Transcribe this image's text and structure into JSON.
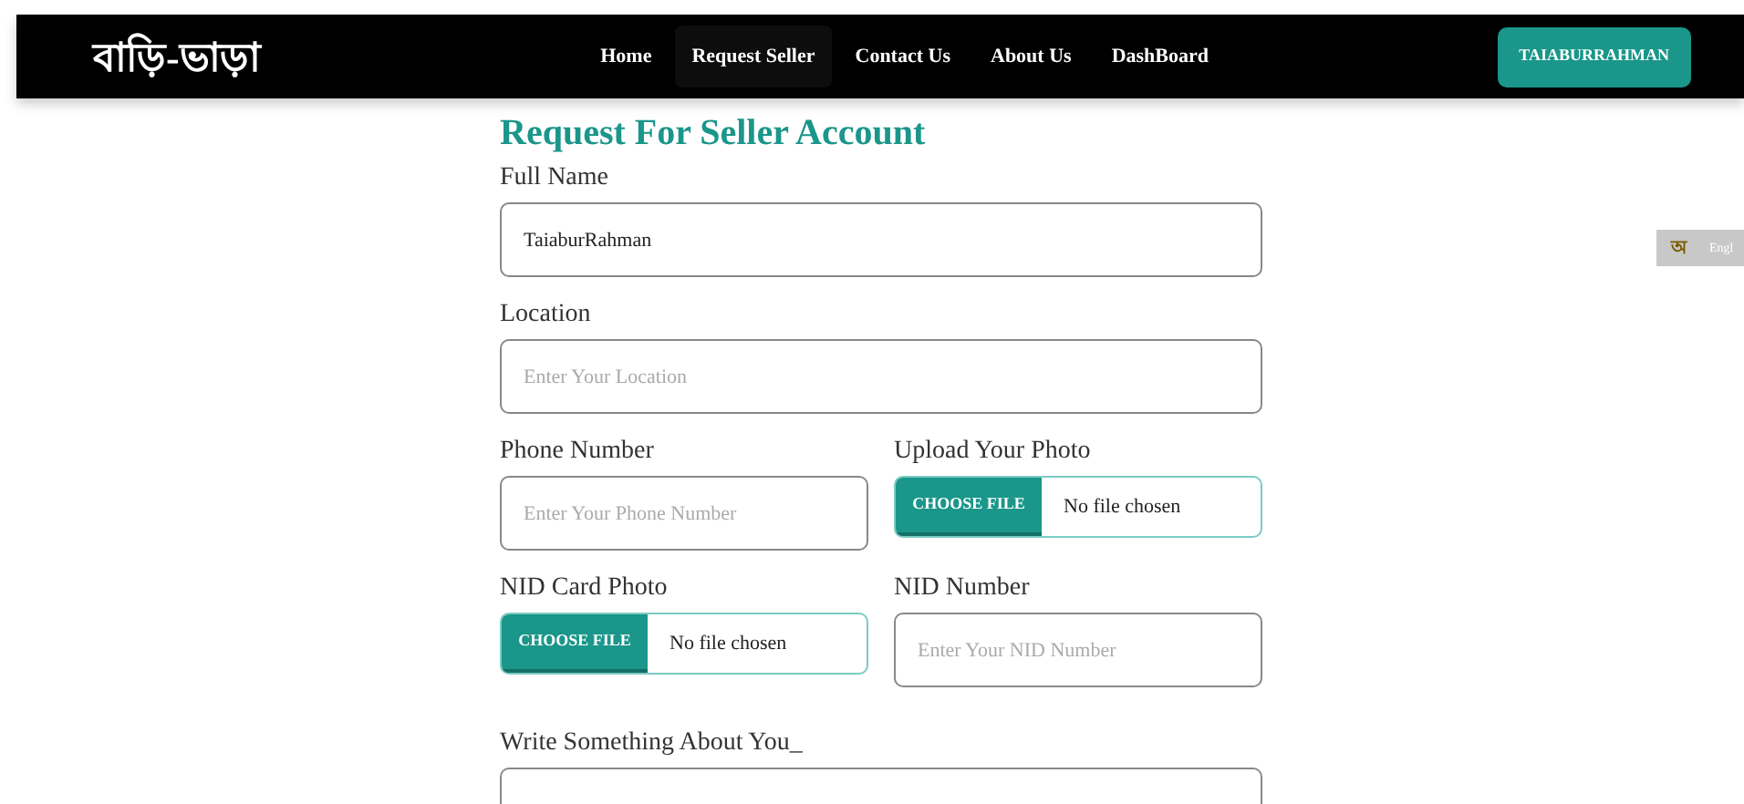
{
  "navbar": {
    "brand": "বাড়ি-ভাড়া",
    "links": [
      {
        "label": "Home",
        "selected": false
      },
      {
        "label": "Request Seller",
        "selected": true
      },
      {
        "label": "Contact Us",
        "selected": false
      },
      {
        "label": "About Us",
        "selected": false
      },
      {
        "label": "DashBoard",
        "selected": false
      }
    ],
    "user_button": "TAIABURRAHMAN"
  },
  "translate_widget": {
    "glyph": "অ",
    "language": "Engl"
  },
  "form": {
    "title": "Request For Seller Account",
    "rows": [
      [
        {
          "kind": "text",
          "label": "Full Name",
          "value": "TaiaburRahman"
        }
      ],
      [
        {
          "kind": "text",
          "label": "Location",
          "placeholder": "Enter Your Location"
        }
      ],
      [
        {
          "kind": "text",
          "label": "Phone Number",
          "placeholder": "Enter Your Phone Number"
        },
        {
          "kind": "file",
          "label": "Upload Your Photo",
          "button": "CHOOSE FILE",
          "status": "No file chosen"
        }
      ],
      [
        {
          "kind": "file",
          "label": "NID Card Photo",
          "button": "CHOOSE FILE",
          "status": "No file chosen"
        },
        {
          "kind": "text",
          "label": "NID Number",
          "placeholder": "Enter Your NID Number"
        }
      ],
      [
        {
          "kind": "textarea",
          "label": "Write Something About You_"
        }
      ]
    ]
  }
}
